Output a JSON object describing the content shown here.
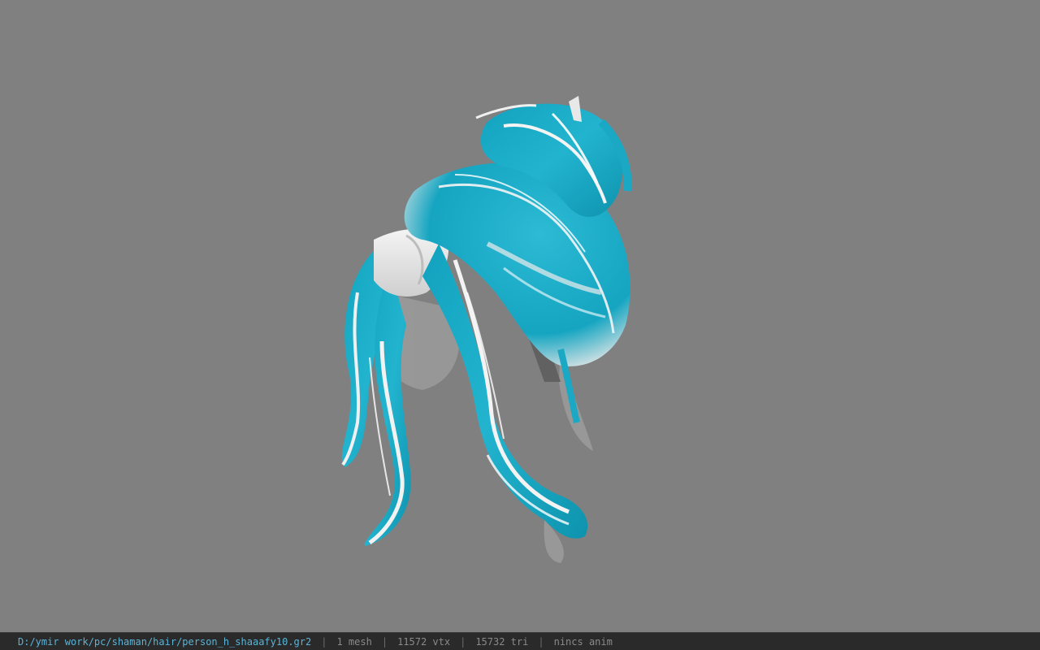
{
  "viewport": {
    "background_color": "#808080",
    "model": {
      "name": "hair-mesh",
      "primary_color": "#1aa8c4",
      "highlight_color": "#f2f2f2",
      "shadow_color": "#9a9a9a"
    }
  },
  "statusbar": {
    "file_path": "D:/ymir work/pc/shaman/hair/person_h_shaaafy10.gr2",
    "separator": "|",
    "mesh_count": "1 mesh",
    "vertex_count": "11572 vtx",
    "triangle_count": "15732 tri",
    "anim_status": "nincs anim"
  }
}
